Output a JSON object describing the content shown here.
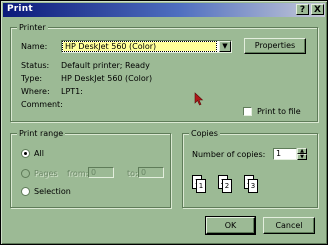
{
  "window": {
    "title": "Print",
    "help_label": "?",
    "close_label": "X"
  },
  "printer": {
    "group_label": "Printer",
    "name_label": "Name:",
    "name_value": "HP DeskJet 560 (Color)",
    "properties_label": "Properties",
    "status_label": "Status:",
    "status_value": "Default printer; Ready",
    "type_label": "Type:",
    "type_value": "HP DeskJet 560 (Color)",
    "where_label": "Where:",
    "where_value": "LPT1:",
    "comment_label": "Comment:",
    "print_to_file_label": "Print to file"
  },
  "print_range": {
    "group_label": "Print range",
    "all_label": "All",
    "pages_label": "Pages",
    "from_label": "from:",
    "from_value": "0",
    "to_label": "to:",
    "to_value": "0",
    "selection_label": "Selection"
  },
  "copies": {
    "group_label": "Copies",
    "number_label": "Number of copies:",
    "number_value": "1",
    "collate_pages": [
      "1",
      "1",
      "2",
      "2",
      "3",
      "3"
    ]
  },
  "buttons": {
    "ok_label": "OK",
    "cancel_label": "Cancel"
  },
  "colors": {
    "face": "#9cba95",
    "title_start": "#0b1a7a",
    "title_end": "#c7cad8",
    "selection_fill": "#ffff99",
    "cursor": "#b01818"
  }
}
